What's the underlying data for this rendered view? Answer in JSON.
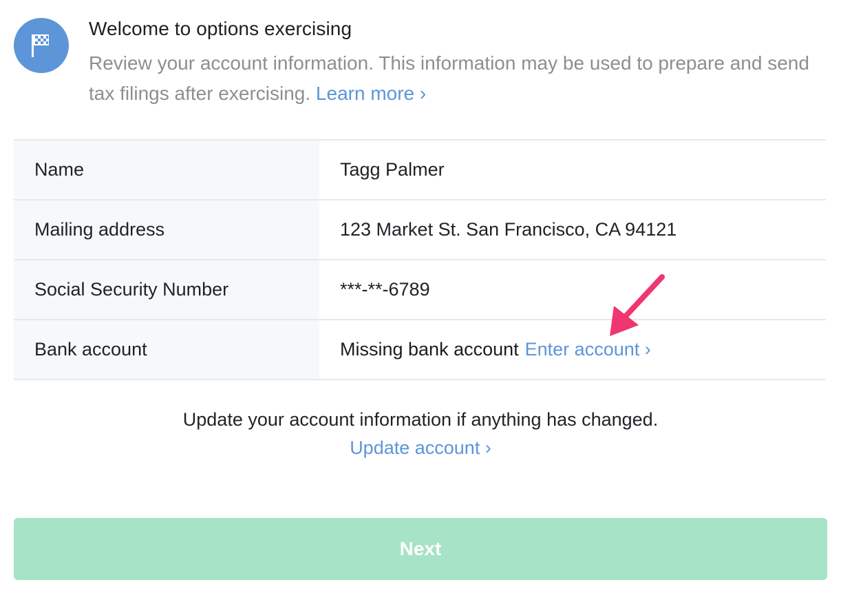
{
  "header": {
    "title": "Welcome to options exercising",
    "description": "Review your account information. This information may be used to prepare and send tax filings after exercising.",
    "learn_more": "Learn more ›",
    "icon": "flag-icon",
    "icon_bg_color": "#5c95d8"
  },
  "account_info": {
    "rows": [
      {
        "label": "Name",
        "value": "Tagg Palmer"
      },
      {
        "label": "Mailing address",
        "value": "123 Market St. San Francisco, CA 94121"
      },
      {
        "label": "Social Security Number",
        "value": "***-**-6789"
      },
      {
        "label": "Bank account",
        "value": "Missing bank account",
        "link": "Enter account ›"
      }
    ]
  },
  "update": {
    "text": "Update your account information if anything has changed.",
    "link": "Update account ›"
  },
  "next_button": {
    "label": "Next",
    "color": "#a6e3c7"
  },
  "colors": {
    "link": "#5c95d8",
    "annotation_arrow": "#f0366f"
  }
}
